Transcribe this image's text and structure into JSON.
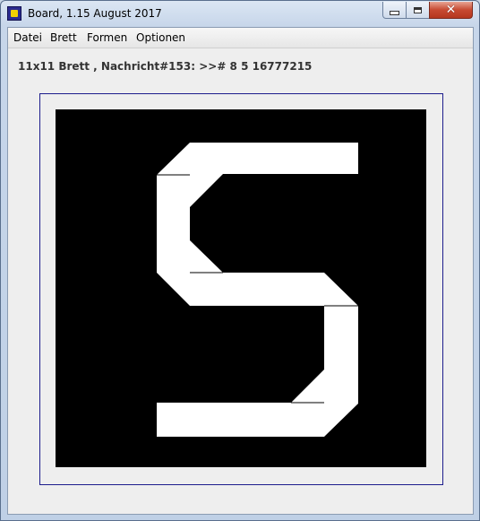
{
  "window": {
    "title": "Board, 1.15 August 2017",
    "app_icon": "board-app-icon",
    "buttons": [
      "minimize-icon",
      "maximize-icon",
      "close-icon"
    ],
    "close_glyph": "✕"
  },
  "menubar": {
    "items": [
      {
        "label": "Datei"
      },
      {
        "label": "Brett"
      },
      {
        "label": "Formen"
      },
      {
        "label": "Optionen"
      }
    ]
  },
  "status": {
    "text": "11x11 Brett , Nachricht#153: >># 8 5 16777215"
  },
  "board": {
    "background_color": "#000000",
    "shape_color": "#ffffff",
    "frame_color": "#1c1c8c"
  }
}
